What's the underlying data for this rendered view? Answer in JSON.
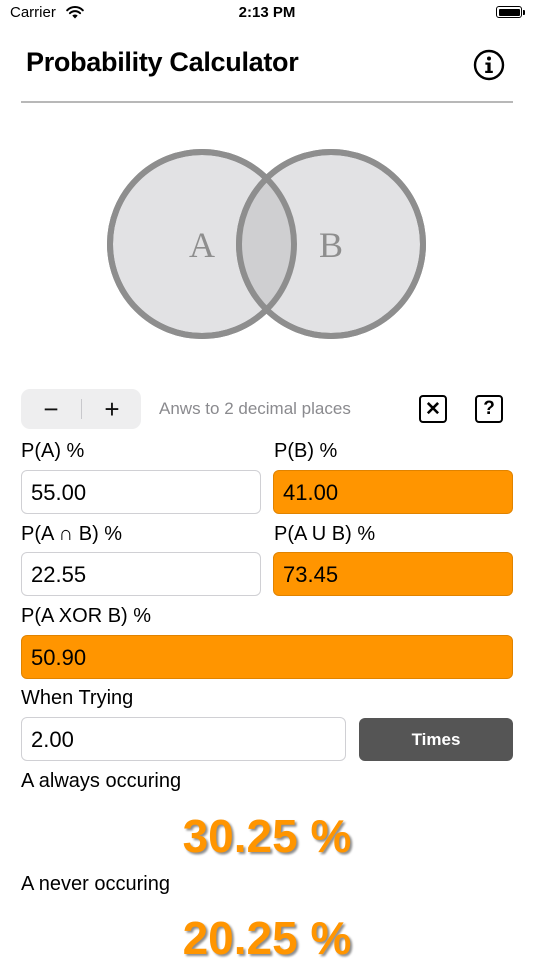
{
  "status": {
    "carrier": "Carrier",
    "time": "2:13 PM"
  },
  "nav": {
    "title": "Probability Calculator",
    "info_icon": "info-circle-icon"
  },
  "venn": {
    "label_a": "A",
    "label_b": "B"
  },
  "toolbar": {
    "minus": "−",
    "plus": "+",
    "decimals_text": "Anws to 2 decimal places",
    "clear_icon": "x-square-icon",
    "help_icon": "question-square-icon",
    "help_glyph": "?",
    "clear_glyph": "✕"
  },
  "fields": {
    "pa": {
      "label": "P(A) %",
      "value": "55.00"
    },
    "pb": {
      "label": "P(B) %",
      "value": "41.00"
    },
    "pa_and_b": {
      "label": "P(A ∩ B) %",
      "value": "22.55"
    },
    "pa_or_b": {
      "label": "P(A U B) %",
      "value": "73.45"
    },
    "pa_xor_b": {
      "label": "P(A XOR B) %",
      "value": "50.90"
    },
    "trying": {
      "label": "When Trying",
      "value": "2.00"
    }
  },
  "times_button": "Times",
  "results": {
    "always_label": "A always occuring",
    "always_value": "30.25 %",
    "never_label": "A never occuring",
    "never_value": "20.25 %"
  },
  "colors": {
    "accent": "#ff9500",
    "button_dark": "#555555",
    "circle_stroke": "#8e8e8e",
    "circle_fill": "#e2e2e4"
  }
}
